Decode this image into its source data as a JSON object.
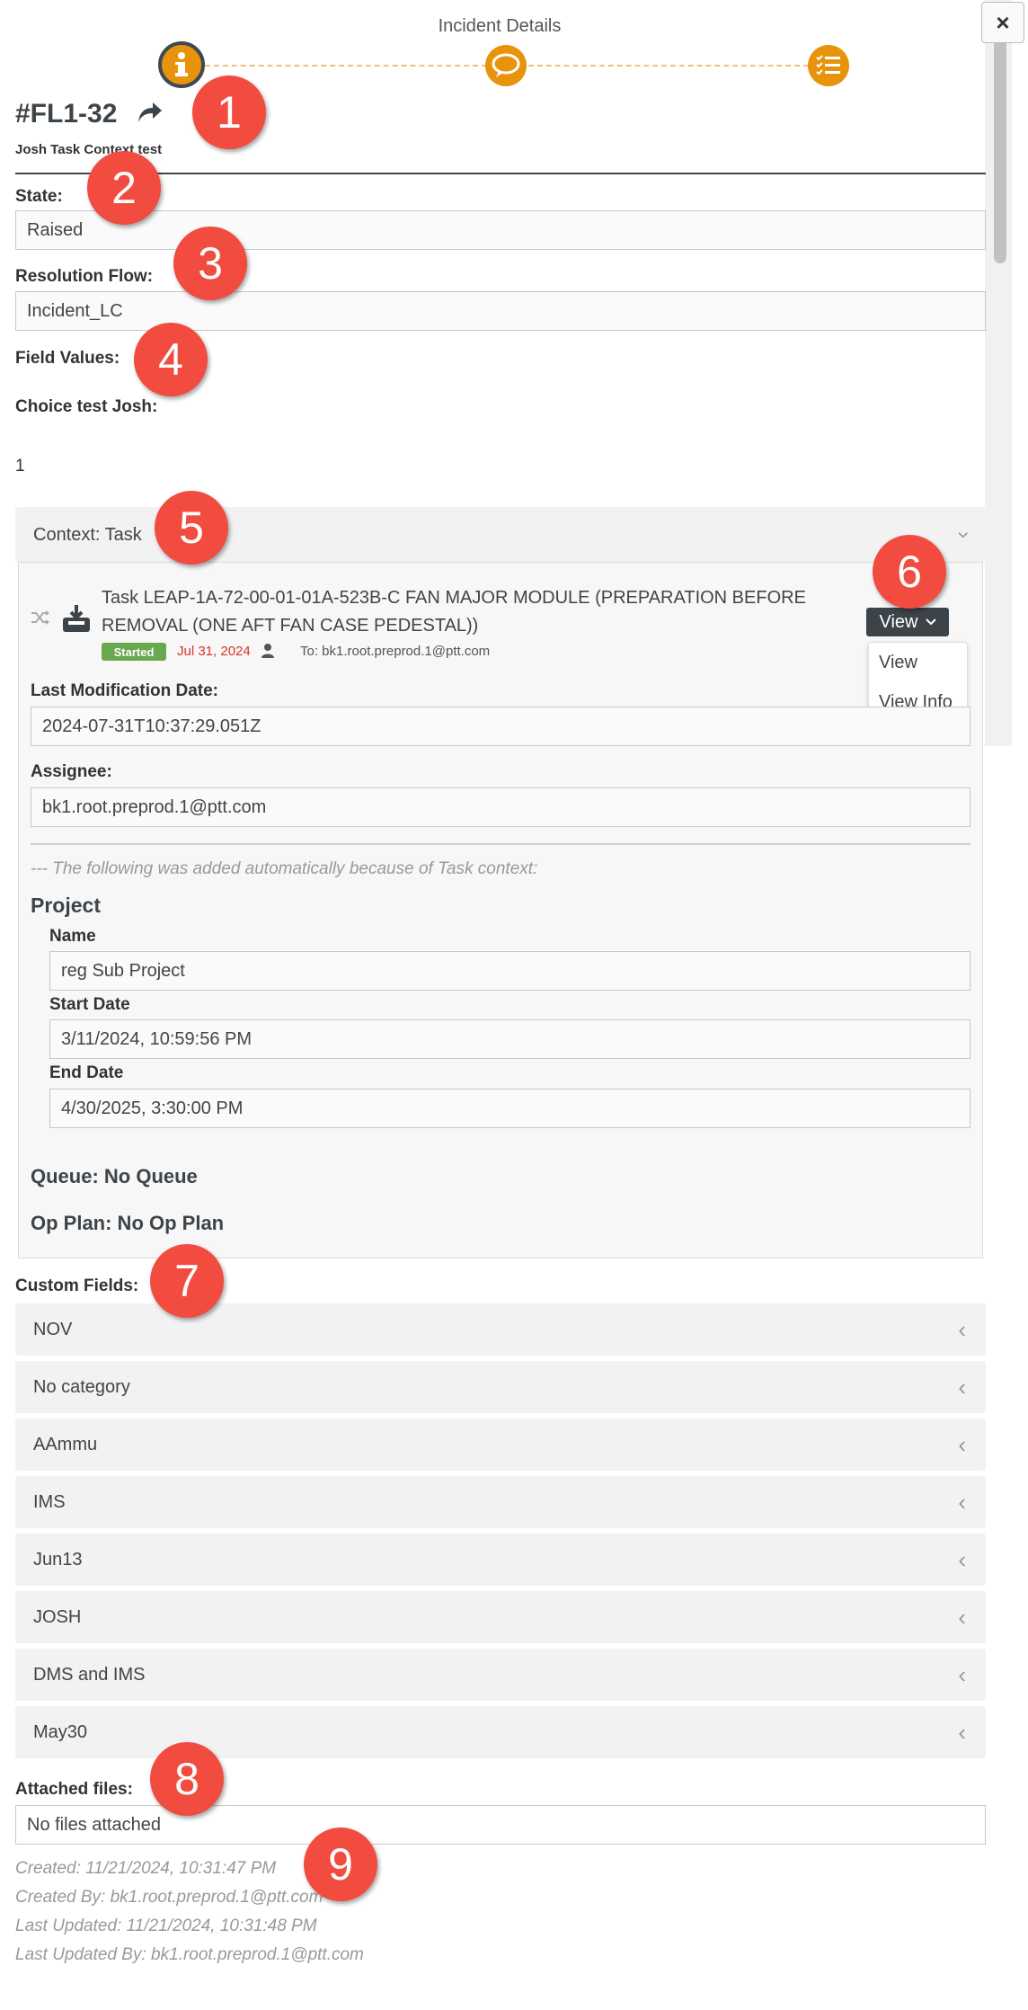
{
  "header": {
    "title": "Incident Details",
    "close": "×"
  },
  "incident": {
    "id": "#FL1-32",
    "subtitle": "Josh Task Context test"
  },
  "state": {
    "label": "State:",
    "value": "Raised"
  },
  "resolution": {
    "label": "Resolution Flow:",
    "value": "Incident_LC"
  },
  "field_values": {
    "label": "Field Values:",
    "choice_label": "Choice test Josh:",
    "choice_value": "1"
  },
  "context": {
    "header": "Context: Task",
    "task_title": "Task LEAP-1A-72-00-01-01A-523B-C FAN MAJOR MODULE (PREPARATION BEFORE REMOVAL (ONE AFT FAN CASE PEDESTAL))",
    "status": "Started",
    "date": "Jul 31, 2024",
    "to": "To: bk1.root.preprod.1@ptt.com",
    "view_button": "View",
    "menu": [
      "View",
      "View Info"
    ],
    "last_mod_label": "Last Modification Date:",
    "last_mod_value": "2024-07-31T10:37:29.051Z",
    "assignee_label": "Assignee:",
    "assignee_value": "bk1.root.preprod.1@ptt.com",
    "auto_note": "--- The following was added automatically because of Task context:",
    "project_title": "Project",
    "name_label": "Name",
    "name_value": "reg Sub Project",
    "start_label": "Start Date",
    "start_value": "3/11/2024, 10:59:56 PM",
    "end_label": "End Date",
    "end_value": "4/30/2025, 3:30:00 PM",
    "queue": "Queue: No Queue",
    "op_plan": "Op Plan: No Op Plan"
  },
  "custom_fields": {
    "label": "Custom Fields:",
    "items": [
      "NOV",
      "No category",
      "AAmmu",
      "IMS",
      "Jun13",
      "JOSH",
      "DMS and IMS",
      "May30"
    ]
  },
  "attached": {
    "label": "Attached files:",
    "value": "No files attached"
  },
  "meta": {
    "created": "Created: 11/21/2024, 10:31:47 PM",
    "created_by": "Created By: bk1.root.preprod.1@ptt.com",
    "updated": "Last Updated: 11/21/2024, 10:31:48 PM",
    "updated_by": "Last Updated By: bk1.root.preprod.1@ptt.com"
  },
  "badges": [
    "1",
    "2",
    "3",
    "4",
    "5",
    "6",
    "7",
    "8",
    "9"
  ],
  "colors": {
    "accent": "#e8930c",
    "badge": "#f24b3f",
    "started": "#6aa84f",
    "date": "#d9342b"
  }
}
